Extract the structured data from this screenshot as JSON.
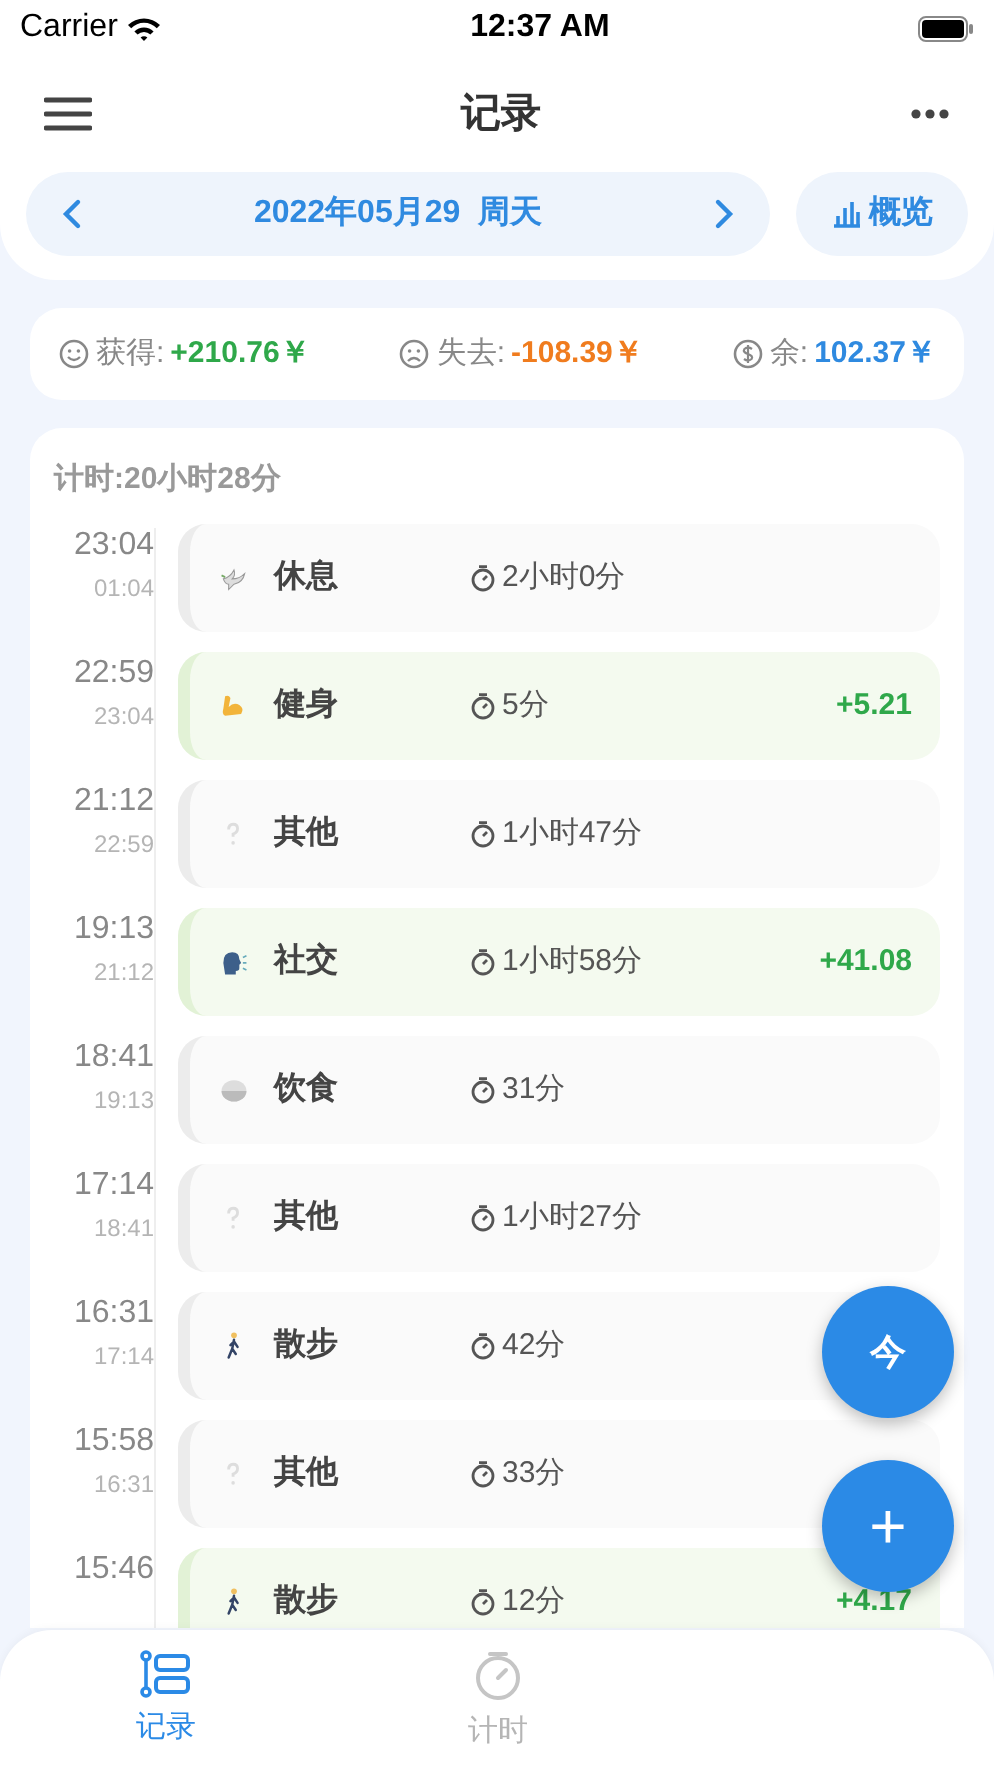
{
  "status_bar": {
    "carrier": "Carrier",
    "time": "12:37 AM"
  },
  "nav": {
    "title": "记录"
  },
  "date_bar": {
    "date": "2022年05月29  周天",
    "overview": "概览"
  },
  "summary": [
    {
      "kind": "gain",
      "label": "获得:",
      "value": "+210.76￥"
    },
    {
      "kind": "loss",
      "label": "失去:",
      "value": "-108.39￥"
    },
    {
      "kind": "balance",
      "label": "余:",
      "value": "102.37￥"
    }
  ],
  "total": "计时:20小时28分",
  "records": [
    {
      "start": "23:04",
      "end": "01:04",
      "kind": "rest",
      "name": "休息",
      "duration": "2小时0分"
    },
    {
      "start": "22:59",
      "end": "23:04",
      "kind": "fitness",
      "name": "健身",
      "duration": "5分",
      "amount": "+5.21"
    },
    {
      "start": "21:12",
      "end": "22:59",
      "kind": "other",
      "name": "其他",
      "duration": "1小时47分"
    },
    {
      "start": "19:13",
      "end": "21:12",
      "kind": "social",
      "name": "社交",
      "duration": "1小时58分",
      "amount": "+41.08"
    },
    {
      "start": "18:41",
      "end": "19:13",
      "kind": "food",
      "name": "饮食",
      "duration": "31分"
    },
    {
      "start": "17:14",
      "end": "18:41",
      "kind": "other",
      "name": "其他",
      "duration": "1小时27分"
    },
    {
      "start": "16:31",
      "end": "17:14",
      "kind": "walk",
      "name": "散步",
      "duration": "42分"
    },
    {
      "start": "15:58",
      "end": "16:31",
      "kind": "other",
      "name": "其他",
      "duration": "33分"
    },
    {
      "start": "15:46",
      "kind": "walk",
      "name": "散步",
      "duration": "12分",
      "amount": "+4.17"
    }
  ],
  "fabs": [
    {
      "kind": "today",
      "label": "今"
    },
    {
      "kind": "add",
      "label": "+"
    }
  ],
  "tabs": [
    {
      "label": "记录",
      "kind": "records",
      "selected": true
    },
    {
      "label": "计时",
      "kind": "timer",
      "selected": false
    }
  ]
}
